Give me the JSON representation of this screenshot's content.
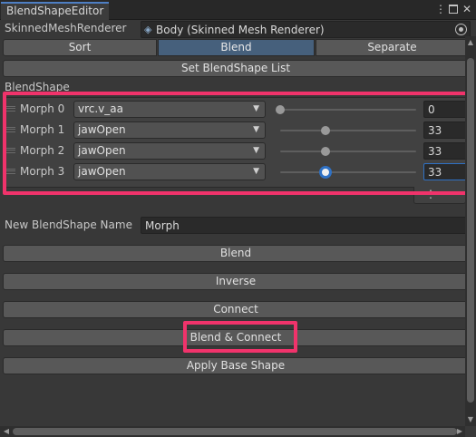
{
  "window": {
    "tab_title": "BlendShapeEditor",
    "menu_icon": "kebab-menu-icon",
    "maximize_icon": "maximize-icon",
    "close_icon": "close-icon"
  },
  "renderer": {
    "label": "SkinnedMeshRenderer",
    "value": "Body (Skinned Mesh Renderer)",
    "object_icon": "skinned-mesh-icon",
    "picker_icon": "object-picker-icon"
  },
  "modes": {
    "sort": "Sort",
    "blend": "Blend",
    "separate": "Separate",
    "active": "Blend"
  },
  "set_list_button": "Set BlendShape List",
  "blendshape_section_label": "BlendShape",
  "morphs": [
    {
      "label": "Morph 0",
      "shape": "vrc.v_aa",
      "value": "0",
      "weight": 0
    },
    {
      "label": "Morph 1",
      "shape": "jawOpen",
      "value": "33",
      "weight": 33
    },
    {
      "label": "Morph 2",
      "shape": "jawOpen",
      "value": "33",
      "weight": 33
    },
    {
      "label": "Morph 3",
      "shape": "jawOpen",
      "value": "33",
      "weight": 33
    }
  ],
  "list_footer_icon": "more-options-icon",
  "new_name": {
    "label": "New BlendShape Name",
    "value": "Morph"
  },
  "actions": {
    "blend": "Blend",
    "inverse": "Inverse",
    "connect": "Connect",
    "blend_connect": "Blend & Connect",
    "apply_base": "Apply Base Shape"
  },
  "colors": {
    "highlight": "#f0336b",
    "active_tab": "#46607c",
    "accent": "#2f71c4"
  }
}
